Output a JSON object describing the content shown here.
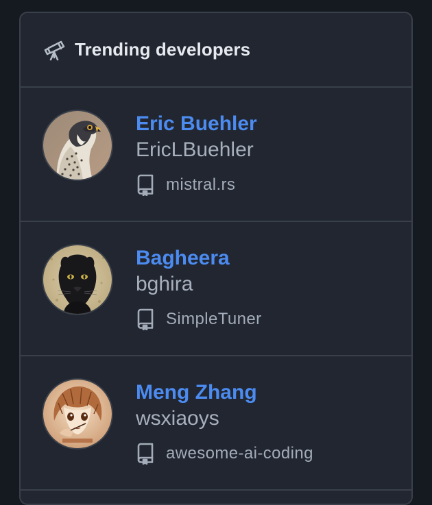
{
  "header": {
    "title": "Trending developers",
    "icon": "telescope-icon"
  },
  "developers": [
    {
      "name": "Eric Buehler",
      "login": "EricLBuehler",
      "repo": "mistral.rs",
      "avatar": "falcon"
    },
    {
      "name": "Bagheera",
      "login": "bghira",
      "repo": "SimpleTuner",
      "avatar": "panther"
    },
    {
      "name": "Meng Zhang",
      "login": "wsxiaoys",
      "repo": "awesome-ai-coding",
      "avatar": "anime-sketch"
    }
  ],
  "colors": {
    "accent": "#4c8bf0",
    "panel": "#212631",
    "border": "#3a404a",
    "text": "#e6e9ee",
    "muted": "#a7b0bc"
  }
}
